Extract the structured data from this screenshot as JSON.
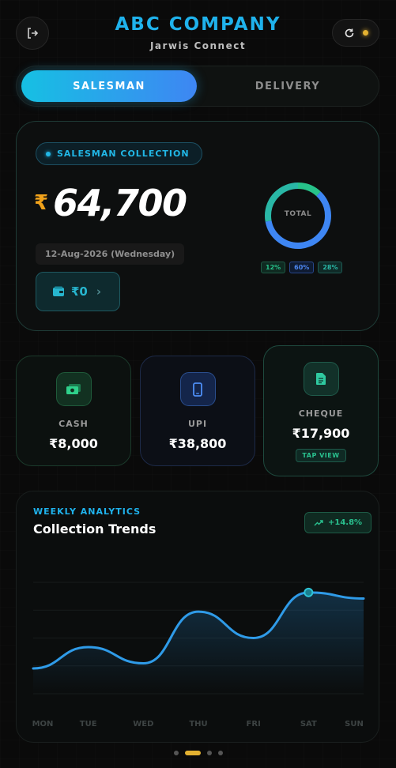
{
  "header": {
    "brand": "ABC COMPANY",
    "subtitle": "Jarwis Connect",
    "logout_icon": "logout-icon",
    "refresh_icon": "refresh-icon",
    "status_color": "#e3b131"
  },
  "tabs": [
    {
      "label": "SALESMAN",
      "active": true
    },
    {
      "label": "DELIVERY",
      "active": false
    }
  ],
  "collection": {
    "chip_label": "SALESMAN COLLECTION",
    "currency_symbol": "₹",
    "amount": "64,700",
    "date": "12-Aug-2026 (Wednesday)",
    "wallet_amount": "₹0",
    "donut_label": "TOTAL",
    "shares": [
      {
        "label": "12%",
        "value": 12,
        "color": "#27c28a"
      },
      {
        "label": "60%",
        "value": 60,
        "color": "#3e86f3"
      },
      {
        "label": "28%",
        "value": 28,
        "color": "#29b7a6"
      }
    ]
  },
  "stats": {
    "cash": {
      "label": "CASH",
      "value": "₹8,000",
      "icon": "cash-icon"
    },
    "upi": {
      "label": "UPI",
      "value": "₹38,800",
      "icon": "phone-icon"
    },
    "cheque": {
      "label": "CHEQUE",
      "value": "₹17,900",
      "icon": "document-icon",
      "action": "TAP VIEW"
    }
  },
  "analytics": {
    "kicker": "WEEKLY ANALYTICS",
    "title": "Collection Trends",
    "trend": "+14.8%",
    "trend_icon": "trending-up-icon"
  },
  "chart_data": {
    "type": "line",
    "categories": [
      "MON",
      "TUE",
      "WED",
      "THU",
      "FRI",
      "SAT",
      "SUN"
    ],
    "values": [
      25,
      46,
      30,
      81,
      55,
      100,
      94
    ],
    "highlight_index": 5,
    "ylim": [
      0,
      110
    ],
    "grid": true,
    "line_color": "#2f9be8"
  },
  "pager": {
    "pages": 4,
    "active": 1
  }
}
